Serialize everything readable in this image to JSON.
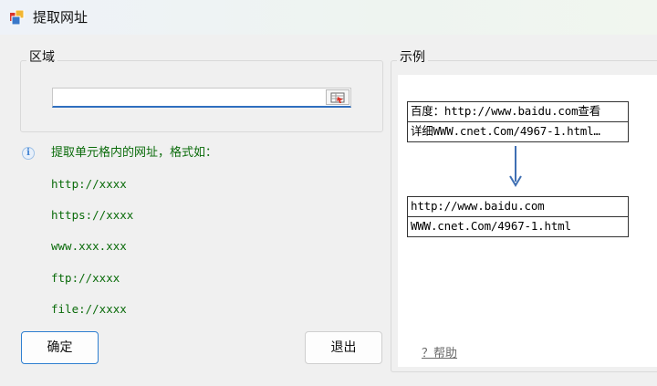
{
  "window": {
    "title": "提取网址"
  },
  "region": {
    "title": "区域",
    "input_value": "",
    "picker_icon": "range-picker-icon"
  },
  "hint": {
    "icon": "info-icon",
    "intro": "提取单元格内的网址，格式如：",
    "formats": [
      "http://xxxx",
      "https://xxxx",
      "www.xxx.xxx",
      "ftp://xxxx",
      "file://xxxx"
    ]
  },
  "buttons": {
    "ok": "确定",
    "exit": "退出"
  },
  "example": {
    "title": "示例",
    "before_rows": [
      "百度：http://www.baidu.com查看",
      "详细WWW.cnet.Com/4967-1.html…"
    ],
    "after_rows": [
      "http://www.baidu.com",
      "WWW.cnet.Com/4967-1.html"
    ],
    "arrow_color": "#3f6fb3",
    "help_label": "？帮助"
  },
  "colors": {
    "hint_text": "#0a6b0a",
    "ok_border": "#2f7fd0",
    "input_underline": "#2f6fbf"
  }
}
